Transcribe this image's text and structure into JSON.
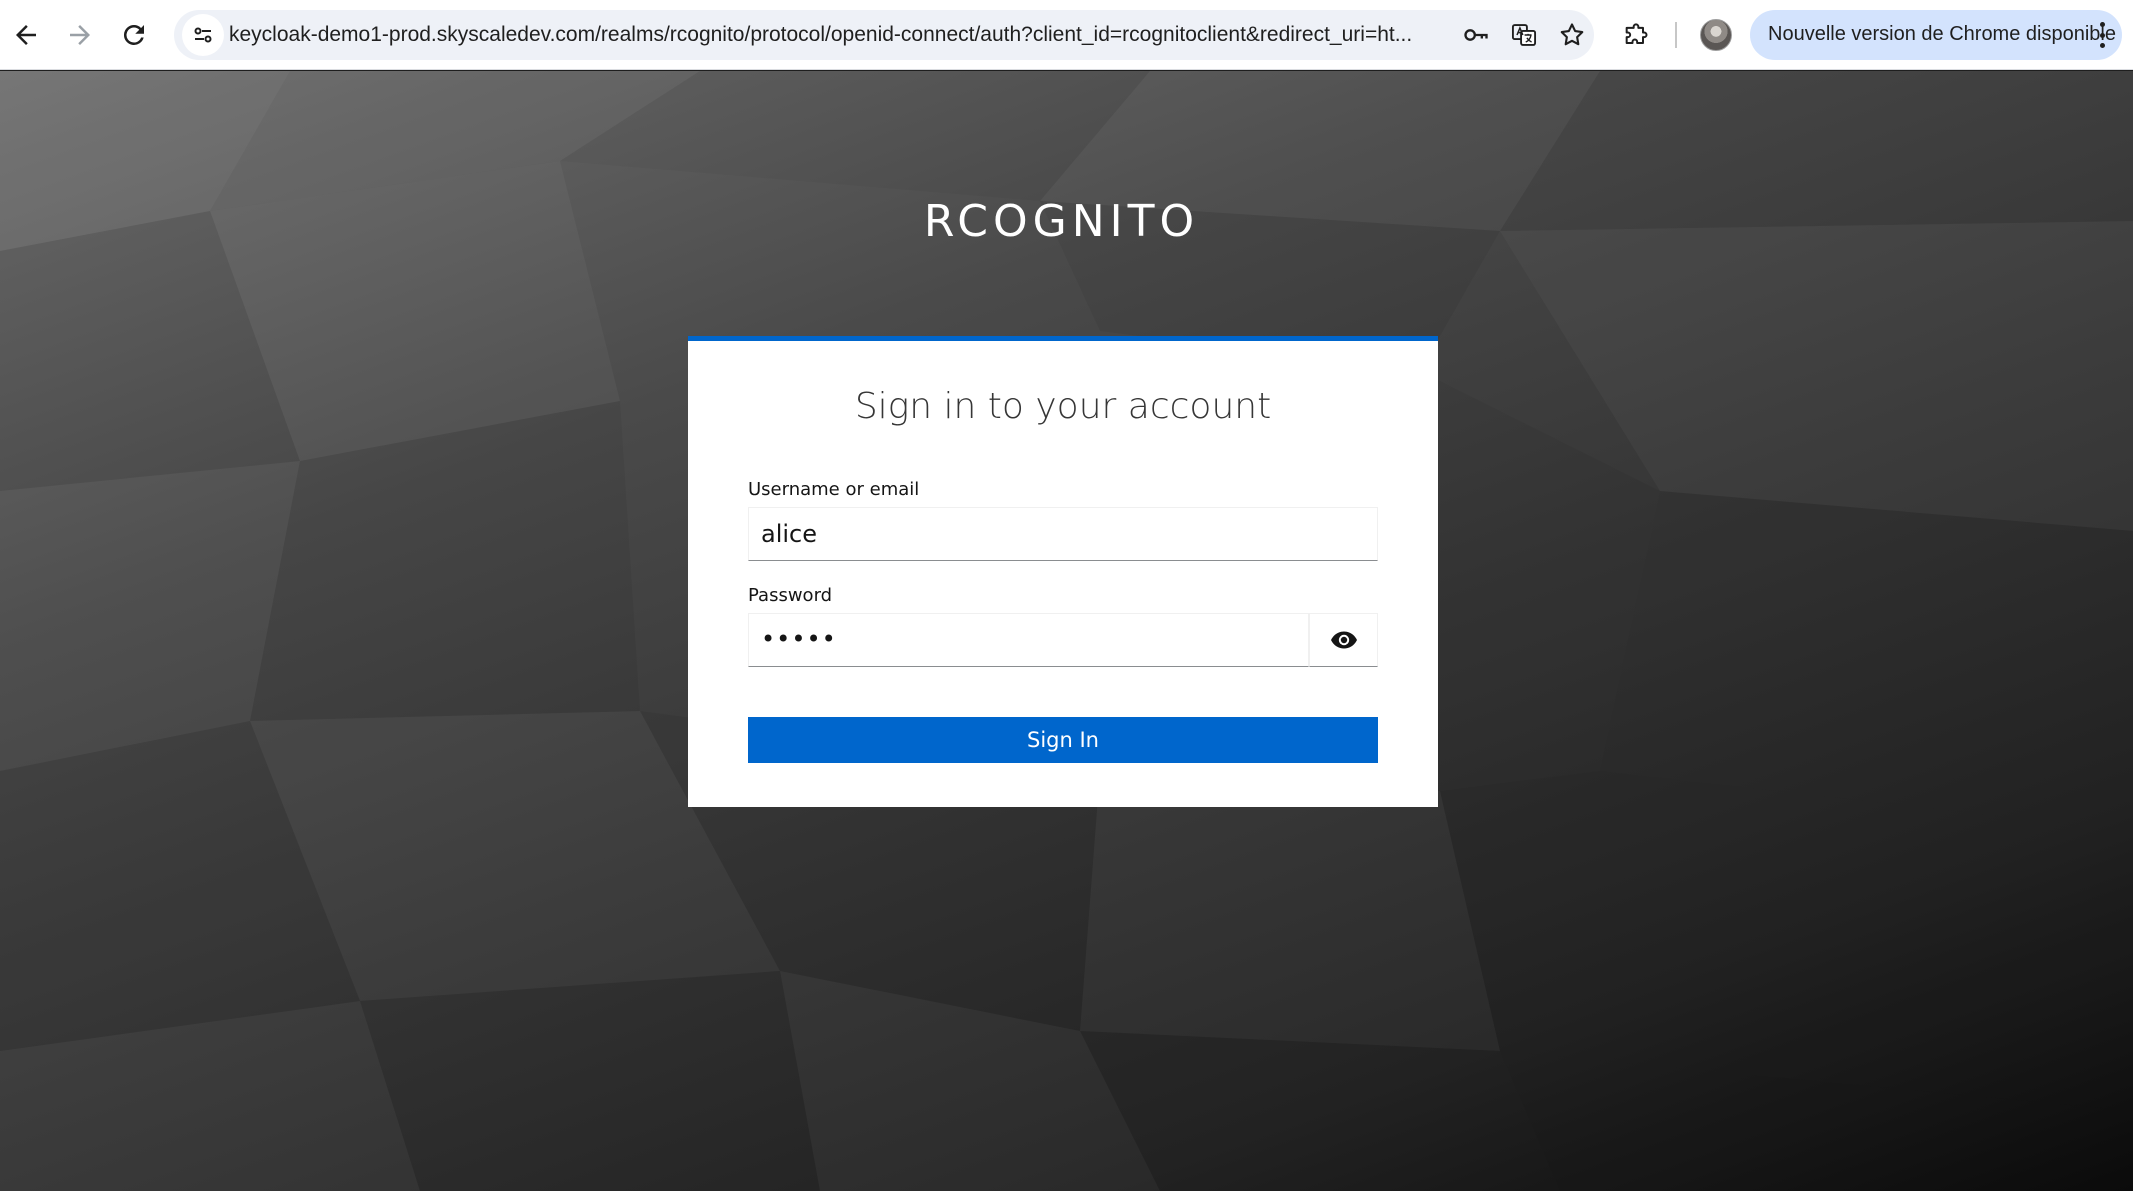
{
  "browser": {
    "url": "keycloak-demo1-prod.skyscaledev.com/realms/rcognito/protocol/openid-connect/auth?client_id=rcognitoclient&redirect_uri=ht...",
    "update_label": "Nouvelle version de Chrome disponible"
  },
  "page": {
    "realm_title": "RCOGNITO",
    "card_title": "Sign in to your account",
    "username_label": "Username or email",
    "username_value": "alice",
    "password_label": "Password",
    "password_value": "•••••",
    "signin_label": "Sign In"
  },
  "colors": {
    "accent": "#0066cc",
    "update_pill": "#d3e3fd"
  }
}
